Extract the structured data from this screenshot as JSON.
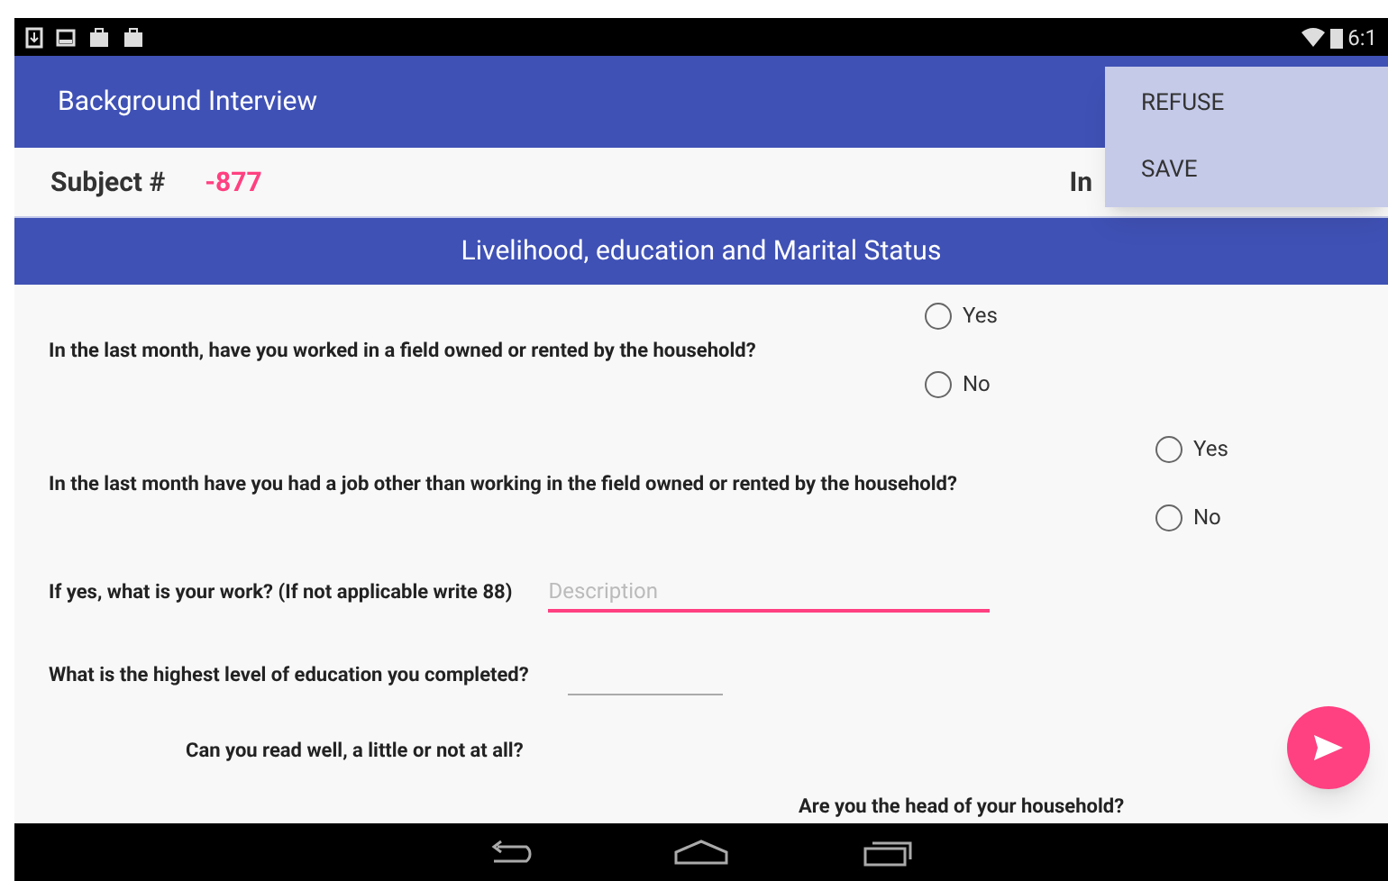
{
  "status_bar": {
    "time": "6:1"
  },
  "app_bar": {
    "title": "Background Interview"
  },
  "overflow_menu": {
    "items": [
      "REFUSE",
      "SAVE"
    ]
  },
  "subject": {
    "label": "Subject #",
    "value": "-877",
    "next_label": "In"
  },
  "section": {
    "title": "Livelihood, education and Marital Status"
  },
  "questions": [
    {
      "kind": "radio",
      "text": "In the last month, have you worked in a field owned or rented by the household?",
      "options": [
        {
          "label": "Yes",
          "selected": false
        },
        {
          "label": "No",
          "selected": false
        }
      ]
    },
    {
      "kind": "radio",
      "text": "In the last month have you had a job other than working in the field owned or rented by the household?",
      "options": [
        {
          "label": "Yes",
          "selected": false
        },
        {
          "label": "No",
          "selected": false
        }
      ]
    },
    {
      "kind": "text",
      "text": "If yes, what is your work? (If not applicable write 88)",
      "placeholder": "Description",
      "focused": true
    },
    {
      "kind": "text",
      "text": "What is the highest level of education you completed?",
      "focused": false
    },
    {
      "kind": "label",
      "text": "Can you read well, a little or not at all?"
    },
    {
      "kind": "label",
      "text": "Are you the head of your household?"
    }
  ]
}
